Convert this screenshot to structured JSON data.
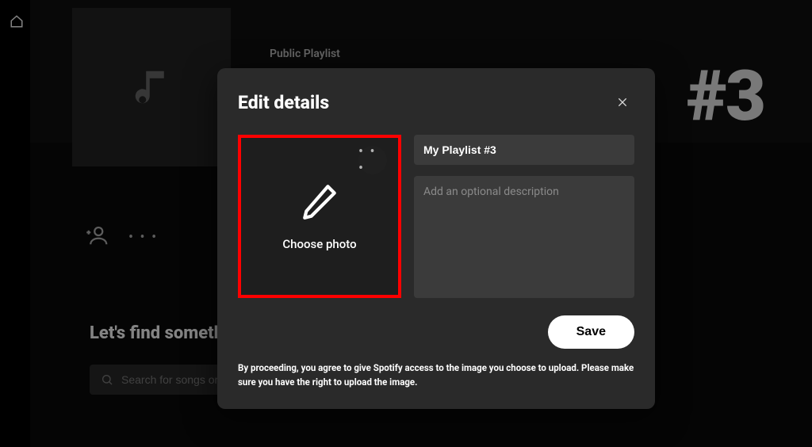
{
  "background": {
    "playlist_type": "Public Playlist",
    "big_title_fragment": "#3",
    "find_heading": "Let's find somethin",
    "search_placeholder": "Search for songs or episo"
  },
  "actions": {
    "more_glyph": "• • •"
  },
  "modal": {
    "title": "Edit details",
    "photo_more_glyph": "• • •",
    "choose_photo_label": "Choose photo",
    "name_value": "My Playlist #3",
    "desc_placeholder": "Add an optional description",
    "save_label": "Save",
    "disclaimer": "By proceeding, you agree to give Spotify access to the image you choose to upload. Please make sure you have the right to upload the image."
  }
}
